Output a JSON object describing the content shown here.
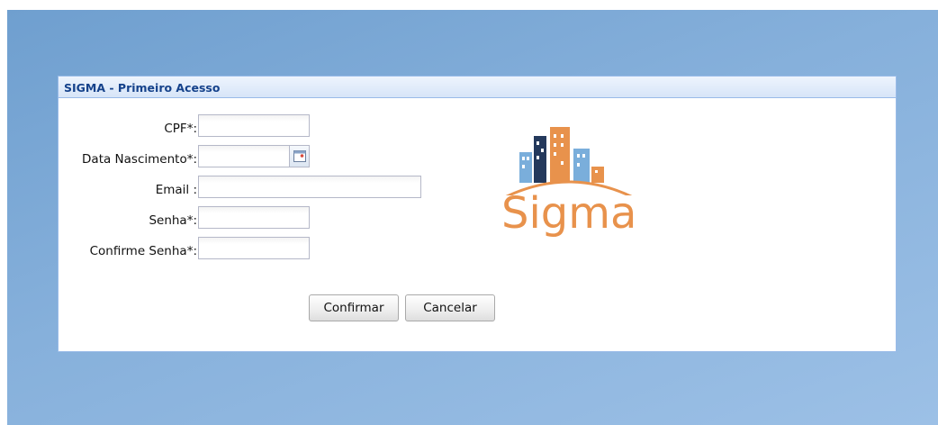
{
  "window": {
    "title": "SIGMA - Primeiro Acesso"
  },
  "form": {
    "cpf": {
      "label": "CPF*:",
      "value": ""
    },
    "birth_date": {
      "label": "Data Nascimento*:",
      "value": ""
    },
    "email": {
      "label": "Email  :",
      "value": ""
    },
    "password": {
      "label": "Senha*:",
      "value": ""
    },
    "confirm_password": {
      "label": "Confirme Senha*:",
      "value": ""
    }
  },
  "buttons": {
    "confirm": "Confirmar",
    "cancel": "Cancelar"
  },
  "logo": {
    "text": "Sigma"
  },
  "icons": {
    "date_trigger": "calendar-icon"
  },
  "colors": {
    "header_text": "#15428b",
    "logo_orange": "#e8924c",
    "logo_navy": "#24395c",
    "logo_blue": "#7aaedb"
  }
}
